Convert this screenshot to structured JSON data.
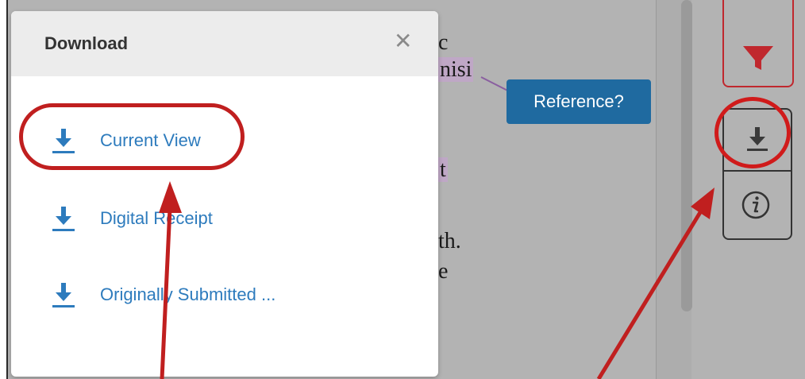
{
  "popup": {
    "title": "Download",
    "close_icon": "✕",
    "items": [
      {
        "label": "Current View",
        "icon": "download-icon"
      },
      {
        "label": "Digital Receipt",
        "icon": "download-icon"
      },
      {
        "label": "Originally Submitted ...",
        "icon": "download-icon"
      }
    ]
  },
  "document": {
    "fragments": [
      "c",
      "nisi",
      "t",
      "th.",
      "e"
    ]
  },
  "reference_badge": {
    "label": "Reference?"
  },
  "side_tools": {
    "filter_icon": "filter-icon",
    "download_icon": "download-icon",
    "info_icon": "info-icon"
  },
  "colors": {
    "link_blue": "#2d7bbd",
    "annotation_red": "#c01f1f",
    "badge_blue": "#1f6aa0",
    "filter_red": "#c0282e"
  }
}
